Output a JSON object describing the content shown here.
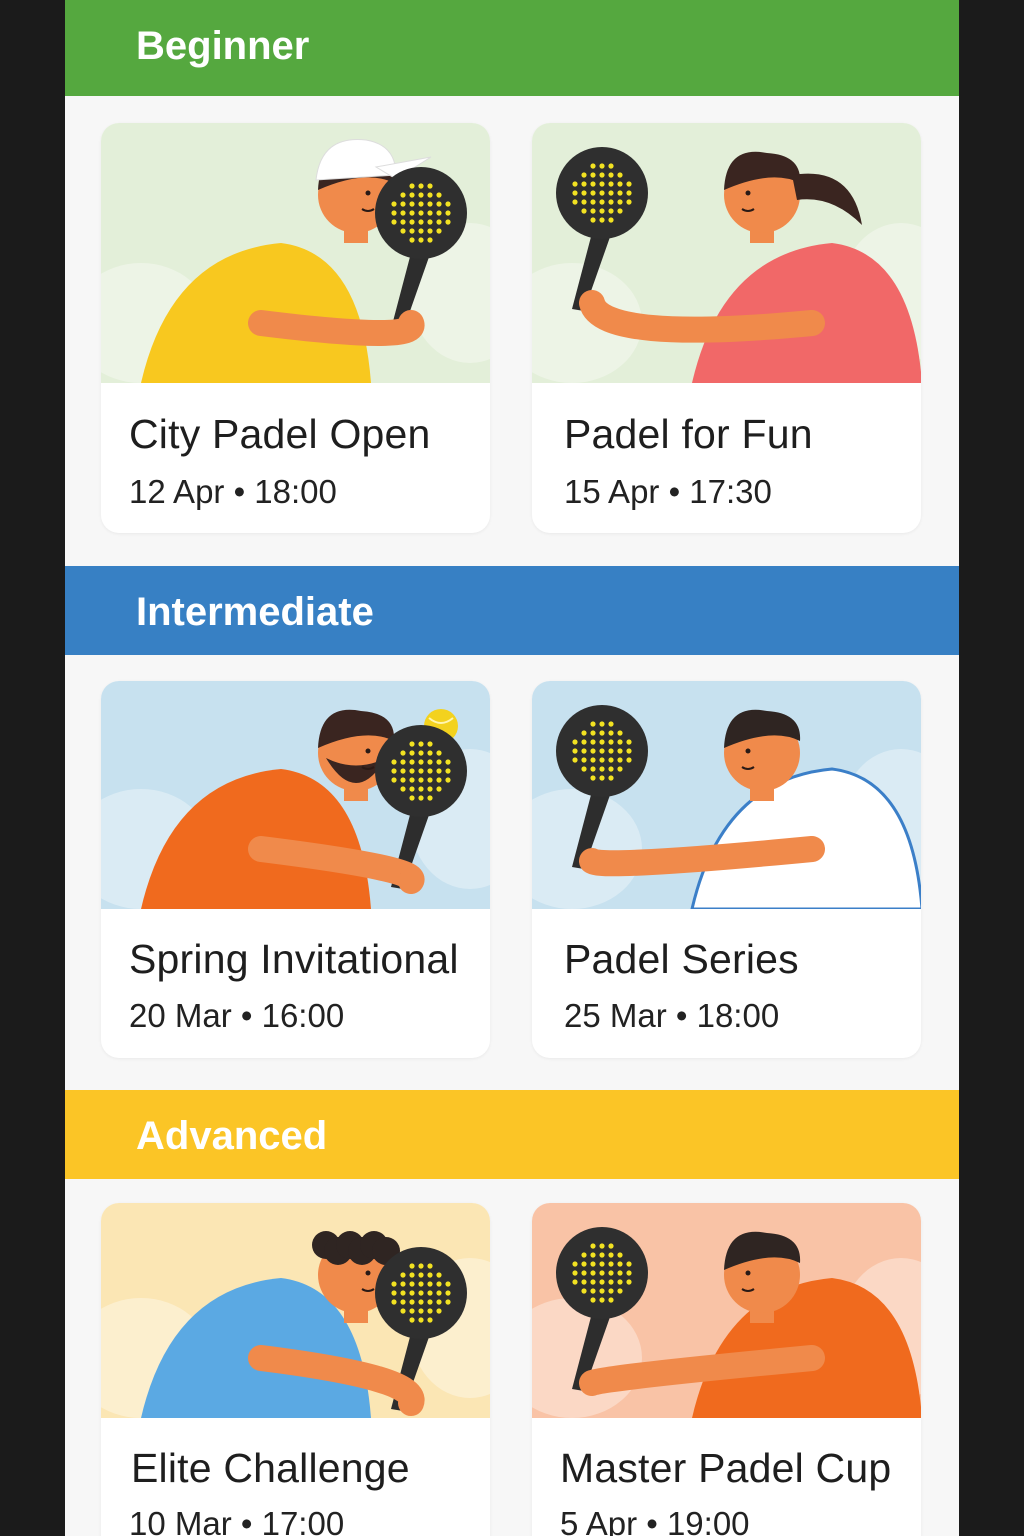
{
  "sections": [
    {
      "heading": "Beginner",
      "color": "#55a83f",
      "events": [
        {
          "title": "City Padel Open",
          "date": "12 Apr • 18:00",
          "bg": "#e3efd9",
          "shirt": "#f8c81f",
          "skin": "#f08a4b",
          "hair": "#3a2520",
          "cap": true
        },
        {
          "title": "Padel for Fun",
          "date": "15 Apr • 17:30",
          "bg": "#e3efd9",
          "shirt": "#f16868",
          "skin": "#f08a4b",
          "hair": "#3a2520",
          "ponytail": true,
          "ball": true
        }
      ]
    },
    {
      "heading": "Intermediate",
      "color": "#3780c4",
      "events": [
        {
          "title": "Spring Invitational",
          "date": "20 Mar • 16:00",
          "bg": "#c7e1ef",
          "shirt": "#f06a1e",
          "skin": "#f08a4b",
          "hair": "#3a2520",
          "beard": true,
          "ball": true
        },
        {
          "title": "Padel Series",
          "date": "25 Mar • 18:00",
          "bg": "#c7e1ef",
          "shirt": "#ffffff",
          "skin": "#f08a4b",
          "hair": "#2f2522"
        }
      ]
    },
    {
      "heading": "Advanced",
      "color": "#fbc526",
      "events": [
        {
          "title": "Elite Challenge",
          "date": "10 Mar • 17:00",
          "bg": "#fbe6b4",
          "shirt": "#5ba9e3",
          "skin": "#f08a4b",
          "hair": "#2f2522",
          "curly": true
        },
        {
          "title": "Master Padel Cup",
          "date": "5 Apr • 19:00",
          "bg": "#f9c3a6",
          "shirt": "#f06a1e",
          "skin": "#f08a4b",
          "hair": "#2f2522"
        }
      ]
    }
  ]
}
